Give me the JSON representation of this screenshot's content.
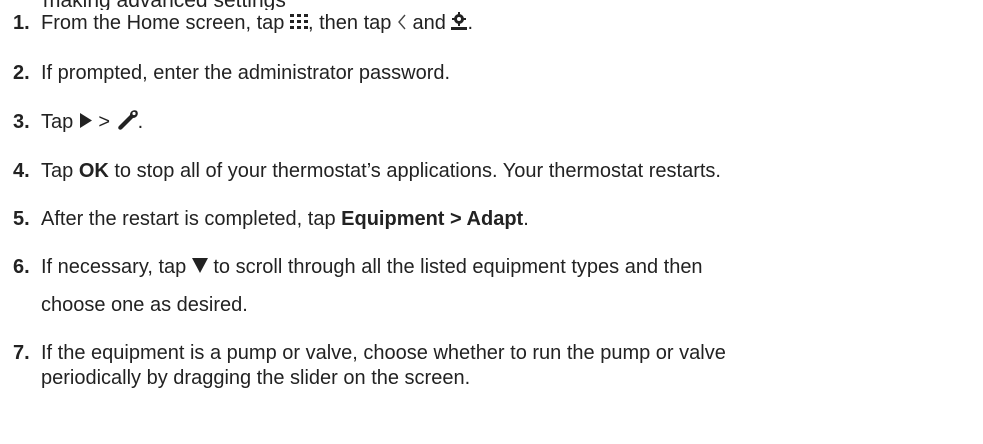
{
  "header_fragment": "making advanced settings",
  "steps": [
    {
      "num": "1.",
      "parts": {
        "a": "From the Home screen, tap ",
        "b": ", then tap ",
        "c": " and ",
        "d": "."
      },
      "icons": [
        "apps-grid-icon",
        "back-chevron-icon",
        "settings-gear-icon"
      ]
    },
    {
      "num": "2.",
      "text": "If prompted, enter the administrator password."
    },
    {
      "num": "3.",
      "parts": {
        "a": "Tap ",
        "b": " > ",
        "c": "."
      },
      "icons": [
        "play-triangle-icon",
        "wrench-icon"
      ]
    },
    {
      "num": "4.",
      "parts": {
        "a": "Tap ",
        "bold": "OK",
        "b": " to stop all of your thermostat’s applications. Your thermostat restarts."
      }
    },
    {
      "num": "5.",
      "parts": {
        "a": "After the restart is completed, tap ",
        "bold1": "Equipment",
        "sep": " > ",
        "bold2": "Adapt",
        "end": "."
      }
    },
    {
      "num": "6.",
      "parts": {
        "a": "If necessary, tap ",
        "b": " to scroll through all the listed equipment types and then",
        "line2": "choose one as desired."
      },
      "icons": [
        "down-triangle-icon"
      ]
    },
    {
      "num": "7.",
      "parts": {
        "line1": "If the equipment is a pump or valve, choose whether to run the pump or valve",
        "line2": "periodically by dragging the slider on the screen."
      }
    }
  ]
}
